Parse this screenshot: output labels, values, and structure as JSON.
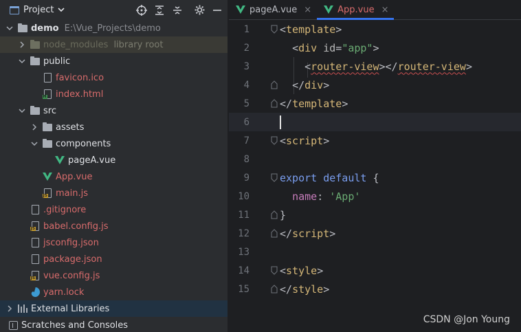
{
  "project_panel": {
    "title": "Project",
    "tree": [
      {
        "name": "demo",
        "extra": "E:\\Vue_Projects\\demo",
        "type": "folder",
        "depth": 0,
        "expanded": true
      },
      {
        "name": "node_modules",
        "extra": "library root",
        "type": "folder-excluded",
        "depth": 1,
        "expanded": false
      },
      {
        "name": "public",
        "type": "folder",
        "depth": 1,
        "expanded": true
      },
      {
        "name": "favicon.ico",
        "type": "file",
        "depth": 2
      },
      {
        "name": "index.html",
        "type": "html",
        "depth": 2
      },
      {
        "name": "src",
        "type": "folder",
        "depth": 1,
        "expanded": true
      },
      {
        "name": "assets",
        "type": "folder",
        "depth": 2,
        "expanded": false
      },
      {
        "name": "components",
        "type": "folder",
        "depth": 2,
        "expanded": true
      },
      {
        "name": "pageA.vue",
        "type": "vue",
        "depth": 3
      },
      {
        "name": "App.vue",
        "type": "vue",
        "depth": 2
      },
      {
        "name": "main.js",
        "type": "js",
        "depth": 2
      },
      {
        "name": ".gitignore",
        "type": "file",
        "depth": 1
      },
      {
        "name": "babel.config.js",
        "type": "js",
        "depth": 1
      },
      {
        "name": "jsconfig.json",
        "type": "file",
        "depth": 1
      },
      {
        "name": "package.json",
        "type": "file",
        "depth": 1
      },
      {
        "name": "vue.config.js",
        "type": "js",
        "depth": 1
      },
      {
        "name": "yarn.lock",
        "type": "yarn",
        "depth": 1
      },
      {
        "name": "External Libraries",
        "type": "libraries",
        "depth": 0
      },
      {
        "name": "Scratches and Consoles",
        "type": "scratches",
        "depth": 0
      }
    ]
  },
  "editor": {
    "tabs": [
      {
        "label": "pageA.vue",
        "active": false,
        "close": "×"
      },
      {
        "label": "App.vue",
        "active": true,
        "close": "×"
      }
    ],
    "line_numbers": [
      "1",
      "2",
      "3",
      "4",
      "5",
      "6",
      "7",
      "8",
      "9",
      "10",
      "11",
      "12",
      "13",
      "14",
      "15"
    ],
    "code": {
      "l1_tag": "template",
      "l2_tag": "div",
      "l2_attr": "id",
      "l2_val": "\"app\"",
      "l3_tag_open": "router-view",
      "l3_tag_close": "router-view",
      "l4_tag": "div",
      "l5_tag": "template",
      "l7_tag": "script",
      "l9_kw1": "export",
      "l9_kw2": "default",
      "l9_brace": "{",
      "l10_key": "name",
      "l10_val": "'App'",
      "l11_brace": "}",
      "l12_tag": "script",
      "l14_tag": "style",
      "l15_tag": "style"
    }
  },
  "watermark": "CSDN @Jon Young",
  "colors": {
    "accent": "#3574f0",
    "vue_green": "#41b883",
    "modified_red": "#d96c6c"
  }
}
